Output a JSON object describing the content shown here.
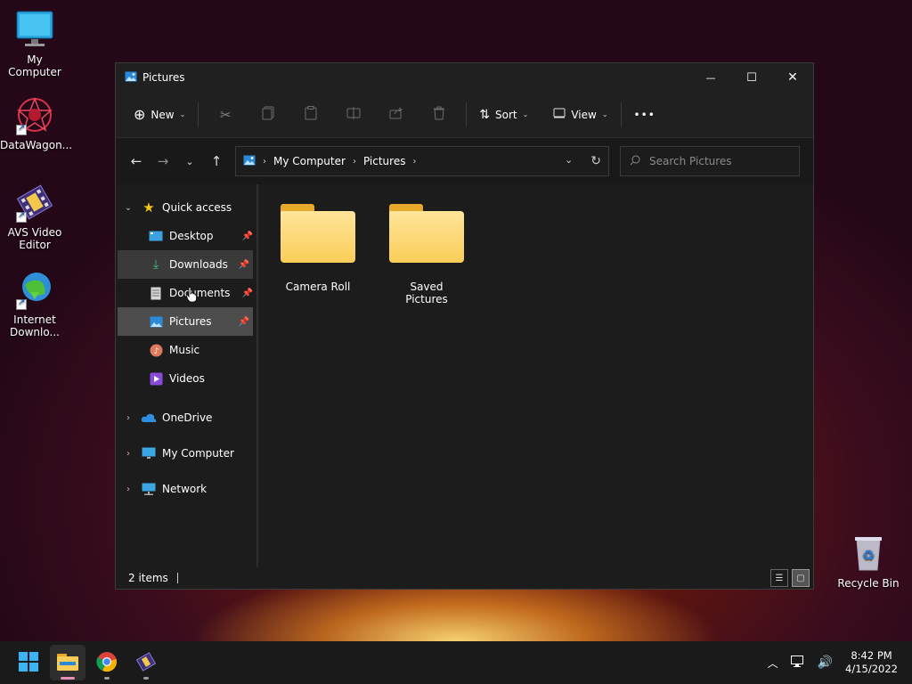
{
  "desktop": {
    "icons": [
      {
        "label": "My Computer"
      },
      {
        "label": "DataWagon..."
      },
      {
        "label": "AVS Video Editor"
      },
      {
        "label": "Internet Downlo..."
      },
      {
        "label": "Recycle Bin"
      }
    ]
  },
  "window": {
    "title": "Pictures",
    "controls": {
      "minimize": "—",
      "maximize": "☐",
      "close": "✕"
    }
  },
  "ribbon": {
    "new_label": "New",
    "sort_label": "Sort",
    "view_label": "View",
    "more_label": "•••"
  },
  "navbar": {
    "breadcrumb": [
      "My Computer",
      "Pictures"
    ],
    "search_placeholder": "Search Pictures"
  },
  "sidebar": {
    "quick_access": "Quick access",
    "items": [
      {
        "label": "Desktop",
        "pinned": true
      },
      {
        "label": "Downloads",
        "pinned": true
      },
      {
        "label": "Documents",
        "pinned": true
      },
      {
        "label": "Pictures",
        "pinned": true
      },
      {
        "label": "Music",
        "pinned": false
      },
      {
        "label": "Videos",
        "pinned": false
      }
    ],
    "roots": [
      {
        "label": "OneDrive"
      },
      {
        "label": "My Computer"
      },
      {
        "label": "Network"
      }
    ]
  },
  "files": [
    {
      "name": "Camera Roll"
    },
    {
      "name": "Saved Pictures"
    }
  ],
  "status": {
    "item_count": "2 items"
  },
  "taskbar": {
    "time": "8:42 PM",
    "date": "4/15/2022"
  },
  "colors": {
    "accent": "#0078d4",
    "folder": "#f9cd58",
    "selection": "#4d4d4d"
  }
}
